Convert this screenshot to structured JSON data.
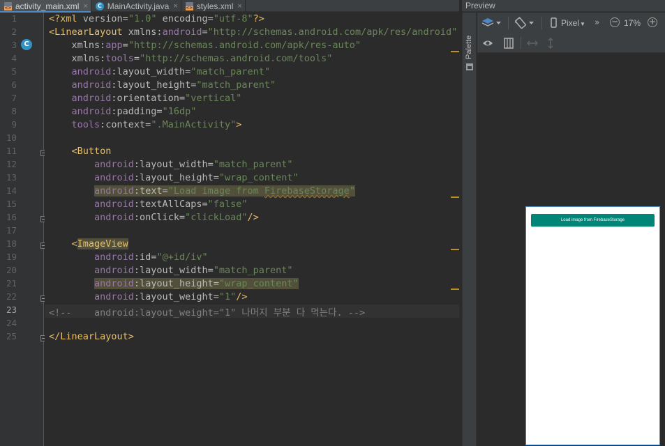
{
  "editor": {
    "tabs": [
      {
        "label": "activity_main.xml",
        "icon": "xml-file-icon",
        "active": true
      },
      {
        "label": "MainActivity.java",
        "icon": "java-class-icon",
        "active": false
      },
      {
        "label": "styles.xml",
        "icon": "xml-file-icon",
        "active": false
      }
    ],
    "close_glyph": "×",
    "gutter_badge": "C",
    "current_line": 23,
    "lines": [
      {
        "n": "1",
        "tokens": [
          [
            "tag",
            "<?xml "
          ],
          [
            "plain",
            "version="
          ],
          [
            "str",
            "\"1.0\""
          ],
          [
            "plain",
            " encoding="
          ],
          [
            "str",
            "\"utf-8\""
          ],
          [
            "tag",
            "?>"
          ]
        ]
      },
      {
        "n": "2",
        "tokens": [
          [
            "tag",
            "<LinearLayout "
          ],
          [
            "plain",
            "xmlns:"
          ],
          [
            "attr",
            "android"
          ],
          [
            "plain",
            "="
          ],
          [
            "str",
            "\"http://schemas.android.com/apk/res/android\""
          ]
        ]
      },
      {
        "n": "3",
        "tokens": [
          [
            "plain",
            "    xmlns:"
          ],
          [
            "attr",
            "app"
          ],
          [
            "plain",
            "="
          ],
          [
            "str",
            "\"http://schemas.android.com/apk/res-auto\""
          ]
        ]
      },
      {
        "n": "4",
        "tokens": [
          [
            "plain",
            "    xmlns:"
          ],
          [
            "attr",
            "tools"
          ],
          [
            "plain",
            "="
          ],
          [
            "str",
            "\"http://schemas.android.com/tools\""
          ]
        ]
      },
      {
        "n": "5",
        "tokens": [
          [
            "attr",
            "    android"
          ],
          [
            "plain",
            ":layout_width="
          ],
          [
            "str",
            "\"match_parent\""
          ]
        ]
      },
      {
        "n": "6",
        "tokens": [
          [
            "attr",
            "    android"
          ],
          [
            "plain",
            ":layout_height="
          ],
          [
            "str",
            "\"match_parent\""
          ]
        ]
      },
      {
        "n": "7",
        "tokens": [
          [
            "attr",
            "    android"
          ],
          [
            "plain",
            ":orientation="
          ],
          [
            "str",
            "\"vertical\""
          ]
        ]
      },
      {
        "n": "8",
        "tokens": [
          [
            "attr",
            "    android"
          ],
          [
            "plain",
            ":padding="
          ],
          [
            "str",
            "\"16dp\""
          ]
        ]
      },
      {
        "n": "9",
        "tokens": [
          [
            "attr",
            "    tools"
          ],
          [
            "plain",
            ":context="
          ],
          [
            "str",
            "\".MainActivity\""
          ],
          [
            "tag",
            ">"
          ]
        ]
      },
      {
        "n": "10",
        "tokens": []
      },
      {
        "n": "11",
        "tokens": [
          [
            "tag",
            "    <Button"
          ]
        ]
      },
      {
        "n": "12",
        "tokens": [
          [
            "attr",
            "        android"
          ],
          [
            "plain",
            ":layout_width="
          ],
          [
            "str",
            "\"match_parent\""
          ]
        ]
      },
      {
        "n": "13",
        "tokens": [
          [
            "attr",
            "        android"
          ],
          [
            "plain",
            ":layout_height="
          ],
          [
            "str",
            "\"wrap_content\""
          ]
        ]
      },
      {
        "n": "14",
        "tokens": [
          [
            "plain",
            "        "
          ],
          [
            "attr hl",
            "android"
          ],
          [
            "plain hl",
            ":text="
          ],
          [
            "str hl",
            "\"Load image from "
          ],
          [
            "str hl warn",
            "FirebaseStorage"
          ],
          [
            "str hl",
            "\""
          ]
        ]
      },
      {
        "n": "15",
        "tokens": [
          [
            "attr",
            "        android"
          ],
          [
            "plain",
            ":textAllCaps="
          ],
          [
            "str",
            "\"false\""
          ]
        ]
      },
      {
        "n": "16",
        "tokens": [
          [
            "attr",
            "        android"
          ],
          [
            "plain",
            ":onClick="
          ],
          [
            "str",
            "\"clickLoad\""
          ],
          [
            "tag",
            "/>"
          ]
        ]
      },
      {
        "n": "17",
        "tokens": []
      },
      {
        "n": "18",
        "tokens": [
          [
            "tag",
            "    <"
          ],
          [
            "tag hl",
            "ImageView"
          ]
        ]
      },
      {
        "n": "19",
        "tokens": [
          [
            "attr",
            "        android"
          ],
          [
            "plain",
            ":id="
          ],
          [
            "str",
            "\"@+id/iv\""
          ]
        ]
      },
      {
        "n": "20",
        "tokens": [
          [
            "attr",
            "        android"
          ],
          [
            "plain",
            ":layout_width="
          ],
          [
            "str",
            "\"match_parent\""
          ]
        ]
      },
      {
        "n": "21",
        "tokens": [
          [
            "plain",
            "        "
          ],
          [
            "attr hl",
            "android"
          ],
          [
            "plain hl",
            ":layout_height="
          ],
          [
            "str hl",
            "\"wrap_content\""
          ]
        ]
      },
      {
        "n": "22",
        "tokens": [
          [
            "attr",
            "        android"
          ],
          [
            "plain",
            ":layout_weight="
          ],
          [
            "str",
            "\"1\""
          ],
          [
            "tag",
            "/>"
          ]
        ]
      },
      {
        "n": "23",
        "tokens": [
          [
            "comment",
            "<!--    android:layout_weight=\"1\" 나머지 부분 다 먹는다. -->"
          ]
        ]
      },
      {
        "n": "24",
        "tokens": []
      },
      {
        "n": "25",
        "tokens": [
          [
            "tag",
            "</LinearLayout>"
          ]
        ]
      }
    ]
  },
  "side_panel": {
    "palette_label": "Palette",
    "palette_icon": "palette-icon"
  },
  "preview": {
    "title": "Preview",
    "toolbar": {
      "layers_icon": "layers-icon",
      "orientation_icon": "rotate-icon",
      "device_label": "Pixel",
      "overflow_glyph": "»",
      "zoom_out": "−",
      "zoom_in": "+",
      "zoom_label": "17%",
      "eye_icon": "eye-icon",
      "blueprint_icon": "blueprint-icon",
      "resize_h_icon": "resize-horizontal-icon",
      "resize_v_icon": "resize-vertical-icon"
    },
    "device_button_label": "Load image from FirebaseStorage",
    "button_color": "#008577"
  },
  "colors": {
    "tag": "#e8bf6a",
    "attr": "#9876aa",
    "string": "#6a8759",
    "comment": "#808080",
    "warning_mark": "#be9117",
    "accent": "#4a88c7"
  }
}
